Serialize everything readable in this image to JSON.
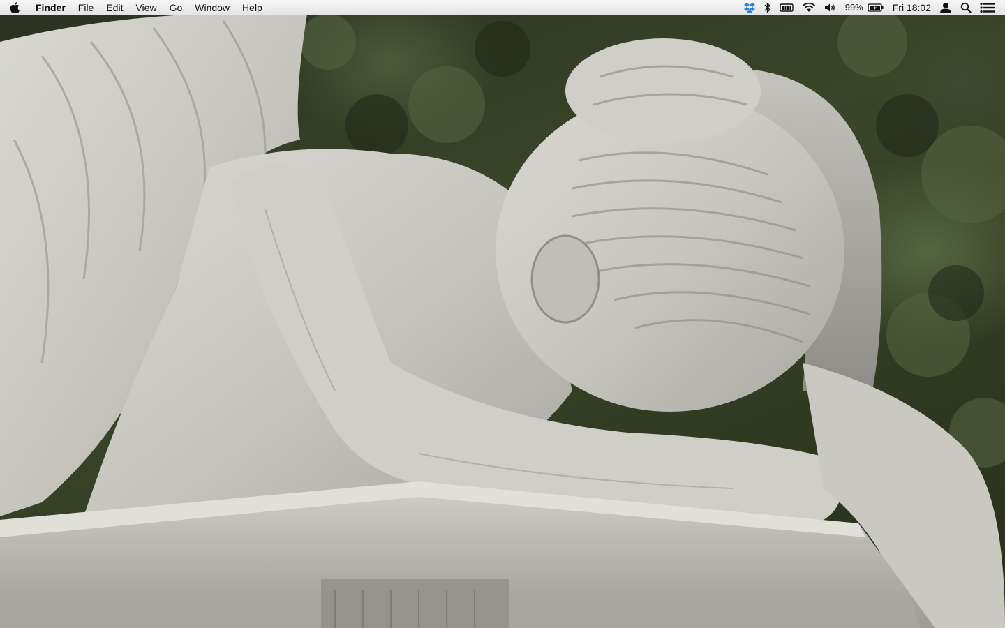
{
  "menubar": {
    "apple_icon": "apple-logo-icon",
    "app_name": "Finder",
    "menus": [
      "File",
      "Edit",
      "View",
      "Go",
      "Window",
      "Help"
    ],
    "status": {
      "battery_percent": "99%",
      "clock": "Fri 18:02",
      "icons": [
        "dropbox-icon",
        "bluetooth-icon",
        "keyboard-icon",
        "wifi-icon",
        "volume-icon",
        "battery-icon",
        "user-icon",
        "spotlight-icon",
        "notification-center-icon"
      ]
    }
  },
  "desktop": {
    "wallpaper": "weeping-angel-statue-photo"
  }
}
